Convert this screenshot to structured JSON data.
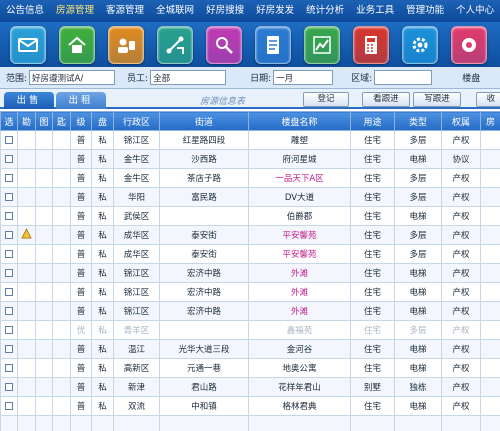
{
  "menu": [
    {
      "label": "公告信息",
      "active": false
    },
    {
      "label": "房源管理",
      "active": true
    },
    {
      "label": "客源管理",
      "active": false
    },
    {
      "label": "全城联网",
      "active": false
    },
    {
      "label": "好房搜搜",
      "active": false
    },
    {
      "label": "好房发发",
      "active": false
    },
    {
      "label": "统计分析",
      "active": false
    },
    {
      "label": "业务工具",
      "active": false
    },
    {
      "label": "管理功能",
      "active": false
    },
    {
      "label": "个人中心",
      "active": false
    }
  ],
  "toolbar_icons": [
    {
      "name": "mail-icon",
      "color": "#2aa0d6"
    },
    {
      "name": "house-icon",
      "color": "#3fae3a"
    },
    {
      "name": "clients-icon",
      "color": "#e08a1e"
    },
    {
      "name": "network-icon",
      "color": "#28a08c"
    },
    {
      "name": "search-user-icon",
      "color": "#c03ab0"
    },
    {
      "name": "document-icon",
      "color": "#2b7bd0"
    },
    {
      "name": "chart-icon",
      "color": "#3aa64a"
    },
    {
      "name": "calculator-icon",
      "color": "#d9352c"
    },
    {
      "name": "settings-icon",
      "color": "#1c8fd8"
    },
    {
      "name": "user-center-icon",
      "color": "#e23a6a"
    }
  ],
  "filters": {
    "scope_label": "范围:",
    "scope_value": "好房遵测试A/",
    "staff_label": "员工:",
    "staff_value": "全部",
    "date_label": "日期:",
    "date_value": "一月",
    "district_label": "区域:",
    "district_value": "",
    "building_label": "楼盘"
  },
  "tabs": {
    "sale": "出售",
    "rent": "出租",
    "title": "房源信息表"
  },
  "buttons": {
    "register": "登记",
    "view_follow": "看跟进",
    "write_follow": "写跟进",
    "collect": "收"
  },
  "table": {
    "headers": [
      "选",
      "勘",
      "图",
      "匙",
      "级",
      "盘",
      "行政区",
      "街道",
      "楼盘名称",
      "用途",
      "类型",
      "权属",
      "房"
    ],
    "rows": [
      {
        "c5": "普",
        "c6": "私",
        "district": "锦江区",
        "street": "红星路四段",
        "estate": "雕塑",
        "use": "住宅",
        "type": "多层",
        "title": "产权",
        "pink": false,
        "grey": false,
        "pin": false
      },
      {
        "c5": "普",
        "c6": "私",
        "district": "金牛区",
        "street": "沙西路",
        "estate": "府河星城",
        "use": "住宅",
        "type": "电梯",
        "title": "协议",
        "pink": false,
        "grey": false,
        "pin": false
      },
      {
        "c5": "普",
        "c6": "私",
        "district": "金牛区",
        "street": "茶店子路",
        "estate": "一品天下A区",
        "use": "住宅",
        "type": "多层",
        "title": "产权",
        "pink": true,
        "grey": false,
        "pin": false
      },
      {
        "c5": "普",
        "c6": "私",
        "district": "华阳",
        "street": "富民路",
        "estate": "DV大道",
        "use": "住宅",
        "type": "多层",
        "title": "产权",
        "pink": false,
        "grey": false,
        "pin": false
      },
      {
        "c5": "普",
        "c6": "私",
        "district": "武侯区",
        "street": "",
        "estate": "伯爵郡",
        "use": "住宅",
        "type": "电梯",
        "title": "产权",
        "pink": false,
        "grey": false,
        "pin": false
      },
      {
        "c5": "普",
        "c6": "私",
        "district": "成华区",
        "street": "泰安街",
        "estate": "平安馨苑",
        "use": "住宅",
        "type": "多层",
        "title": "产权",
        "pink": true,
        "grey": false,
        "pin": true
      },
      {
        "c5": "普",
        "c6": "私",
        "district": "成华区",
        "street": "泰安街",
        "estate": "平安馨苑",
        "use": "住宅",
        "type": "多层",
        "title": "产权",
        "pink": true,
        "grey": false,
        "pin": false
      },
      {
        "c5": "普",
        "c6": "私",
        "district": "锦江区",
        "street": "宏济中路",
        "estate": "外滩",
        "use": "住宅",
        "type": "电梯",
        "title": "产权",
        "pink": true,
        "grey": false,
        "pin": false
      },
      {
        "c5": "普",
        "c6": "私",
        "district": "锦江区",
        "street": "宏济中路",
        "estate": "外滩",
        "use": "住宅",
        "type": "电梯",
        "title": "产权",
        "pink": true,
        "grey": false,
        "pin": false
      },
      {
        "c5": "普",
        "c6": "私",
        "district": "锦江区",
        "street": "宏济中路",
        "estate": "外滩",
        "use": "住宅",
        "type": "电梯",
        "title": "产权",
        "pink": true,
        "grey": false,
        "pin": false
      },
      {
        "c5": "优",
        "c6": "私",
        "district": "青羊区",
        "street": "",
        "estate": "鑫福苑",
        "use": "住宅",
        "type": "多层",
        "title": "产权",
        "pink": false,
        "grey": true,
        "pin": false
      },
      {
        "c5": "普",
        "c6": "私",
        "district": "温江",
        "street": "光华大道三段",
        "estate": "金河谷",
        "use": "住宅",
        "type": "电梯",
        "title": "产权",
        "pink": false,
        "grey": false,
        "pin": false
      },
      {
        "c5": "普",
        "c6": "私",
        "district": "高新区",
        "street": "元通一巷",
        "estate": "地奥公寓",
        "use": "住宅",
        "type": "电梯",
        "title": "产权",
        "pink": false,
        "grey": false,
        "pin": false
      },
      {
        "c5": "普",
        "c6": "私",
        "district": "新津",
        "street": "君山路",
        "estate": "花样年君山",
        "use": "别墅",
        "type": "独栋",
        "title": "产权",
        "pink": false,
        "grey": false,
        "pin": false
      },
      {
        "c5": "普",
        "c6": "私",
        "district": "双流",
        "street": "中和镇",
        "estate": "格林君典",
        "use": "住宅",
        "type": "电梯",
        "title": "产权",
        "pink": false,
        "grey": false,
        "pin": false
      },
      {
        "c5": "",
        "c6": "",
        "district": "",
        "street": "",
        "estate": "",
        "use": "",
        "type": "",
        "title": "",
        "pink": false,
        "grey": false,
        "pin": false
      }
    ]
  }
}
